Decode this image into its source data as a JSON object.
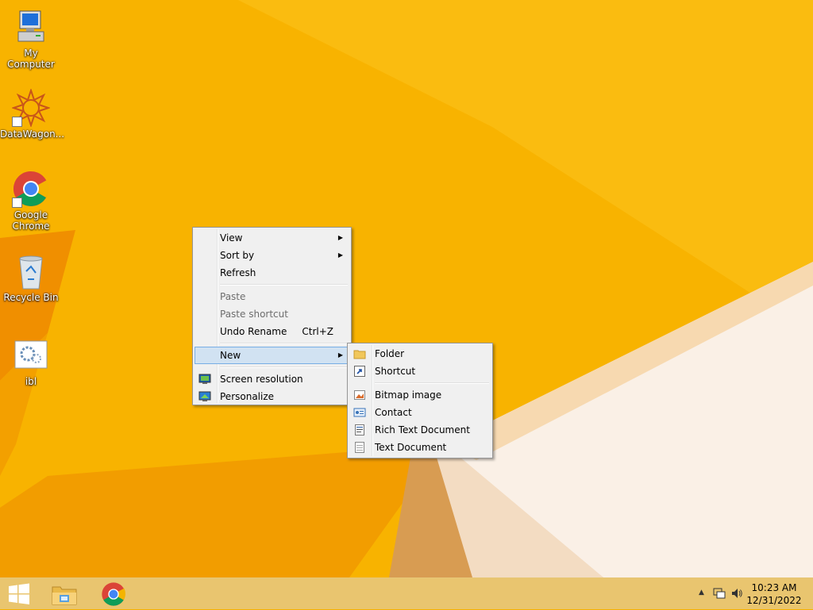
{
  "desktop": {
    "icons": [
      {
        "label": "My Computer",
        "icon": "computer-icon"
      },
      {
        "label": "DataWagon...",
        "icon": "datawagon-icon"
      },
      {
        "label": "Google Chrome",
        "icon": "chrome-icon"
      },
      {
        "label": "Recycle Bin",
        "icon": "recycle-bin-icon"
      },
      {
        "label": "ibl",
        "icon": "settings-file-icon"
      }
    ]
  },
  "context_menu": {
    "items": [
      {
        "label": "View",
        "submenu": true
      },
      {
        "label": "Sort by",
        "submenu": true
      },
      {
        "label": "Refresh"
      },
      {
        "label": "Paste",
        "disabled": true
      },
      {
        "label": "Paste shortcut",
        "disabled": true
      },
      {
        "label": "Undo Rename",
        "accelerator": "Ctrl+Z"
      },
      {
        "label": "New",
        "submenu": true,
        "highlighted": true
      },
      {
        "label": "Screen resolution",
        "icon": "screen-resolution-icon"
      },
      {
        "label": "Personalize",
        "icon": "personalize-icon"
      }
    ]
  },
  "new_submenu": {
    "items": [
      {
        "label": "Folder",
        "icon": "folder-icon"
      },
      {
        "label": "Shortcut",
        "icon": "shortcut-icon"
      },
      {
        "label": "Bitmap image",
        "icon": "bitmap-icon"
      },
      {
        "label": "Contact",
        "icon": "contact-icon"
      },
      {
        "label": "Rich Text Document",
        "icon": "rich-text-icon"
      },
      {
        "label": "Text Document",
        "icon": "text-document-icon"
      }
    ]
  },
  "taskbar": {
    "pinned": [
      "start-icon",
      "file-explorer-icon",
      "chrome-icon"
    ],
    "clock_time": "10:23 AM",
    "clock_date": "12/31/2022"
  },
  "colors": {
    "wallpaper": "#f7b100",
    "menu_bg": "#f0f0f0",
    "menu_highlight": "#d1e2f2"
  }
}
